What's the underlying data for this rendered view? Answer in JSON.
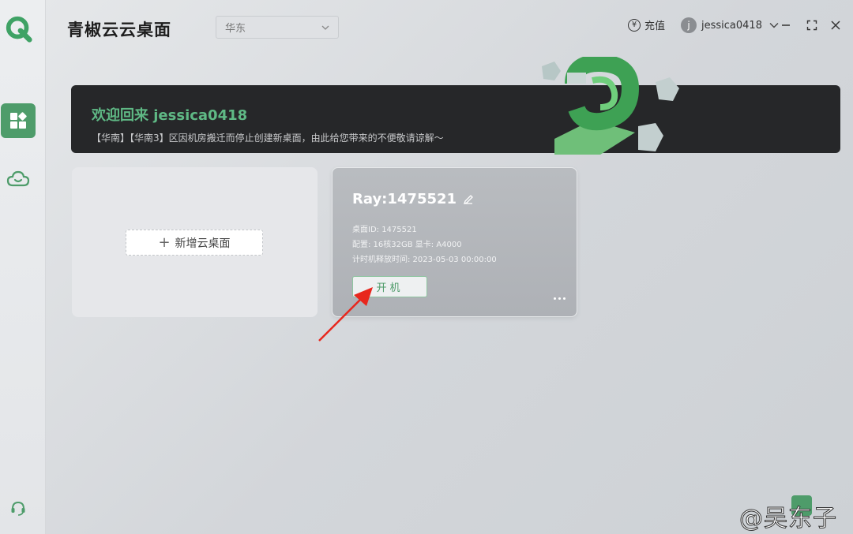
{
  "app": {
    "title": "青椒云云桌面",
    "brand_color": "#4e9c6a"
  },
  "header": {
    "region": "华东",
    "recharge_label": "充值",
    "recharge_icon_glyph": "¥",
    "username": "jessica0418",
    "avatar_letter": "j"
  },
  "banner": {
    "title": "欢迎回来 jessica0418",
    "notice": "【华南】【华南3】区因机房搬迁而停止创建新桌面，由此给您带来的不便敬请谅解～"
  },
  "add_card": {
    "label": "新增云桌面",
    "plus": "+"
  },
  "desktop": {
    "name": "Ray:1475521",
    "id_line": "桌面ID: 1475521",
    "config_line": "配置: 16核32GB   显卡: A4000",
    "release_line": "计时机释放时间: 2023-05-03 00:00:00",
    "start_label": "开机"
  },
  "watermark": "@吴东子"
}
